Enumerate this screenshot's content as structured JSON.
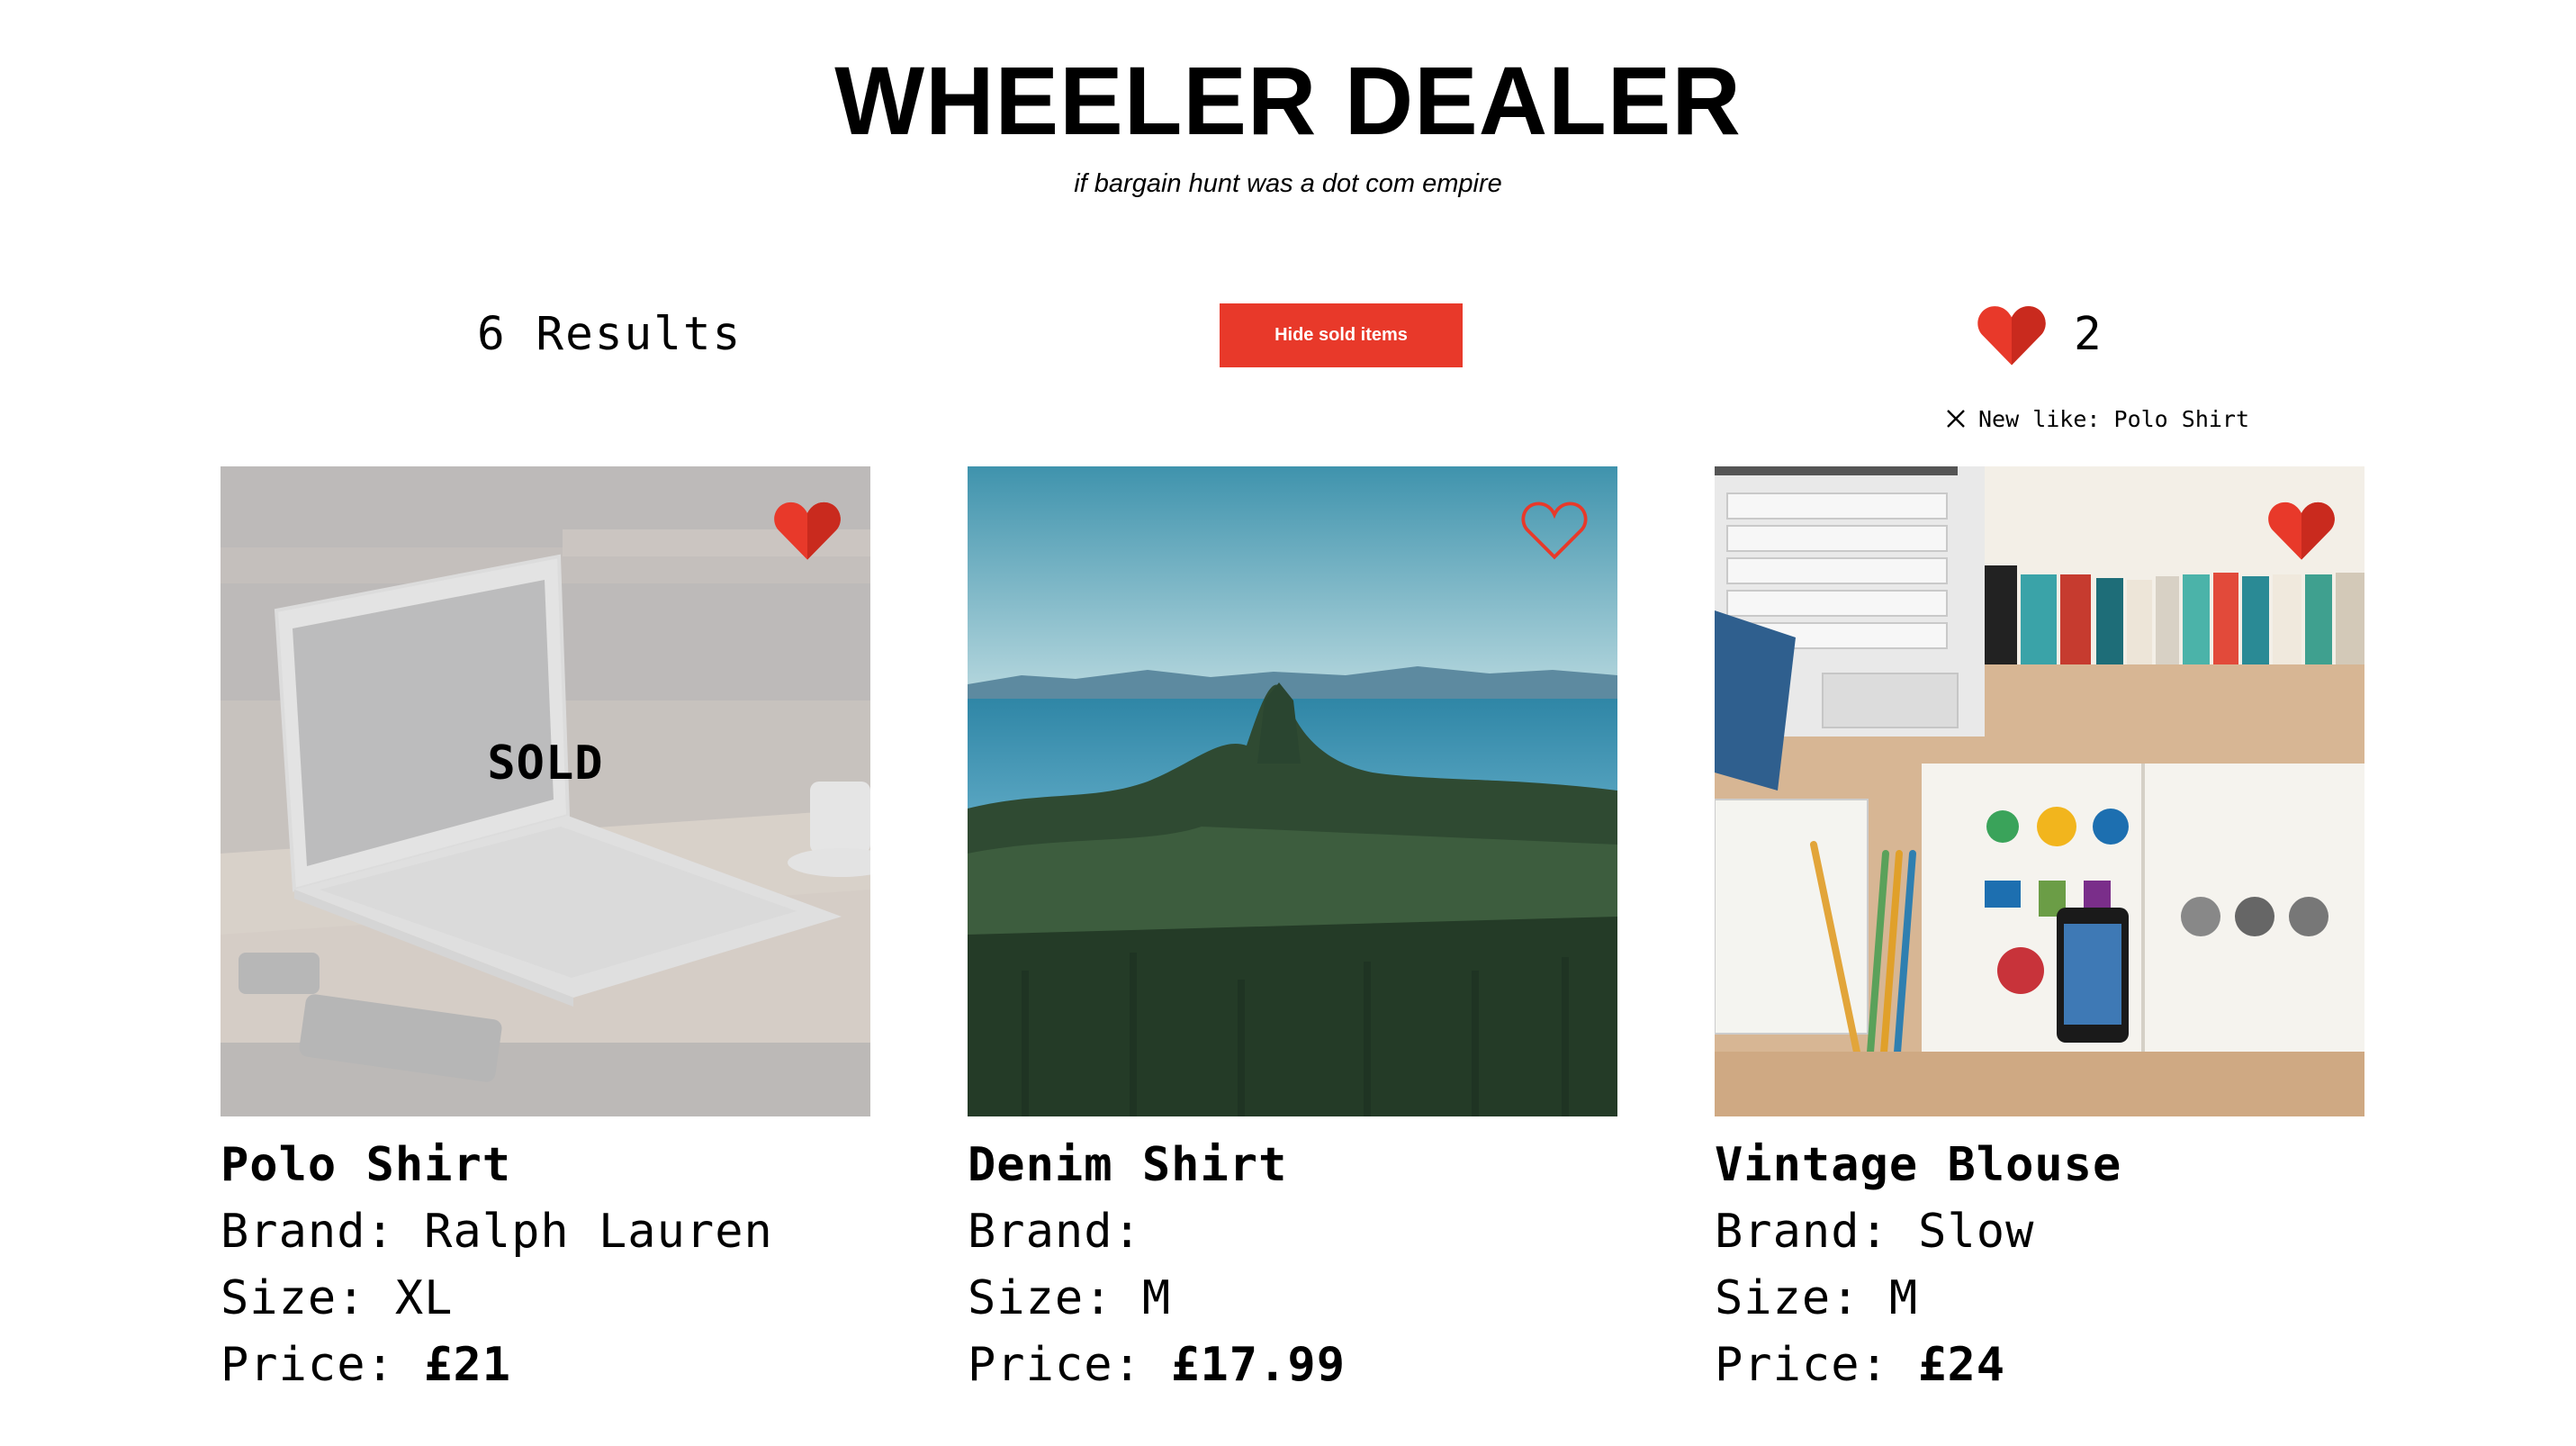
{
  "header": {
    "title": "WHEELER DEALER",
    "tagline": "if bargain hunt was a dot com empire"
  },
  "toolbar": {
    "results_label": "6 Results",
    "hide_sold_label": "Hide sold items",
    "likes_count": "2",
    "notice_text": "New like: Polo Shirt"
  },
  "colors": {
    "accent": "#e8392a",
    "heart": "#e8392a"
  },
  "icons": {
    "likes": "heart-icon",
    "notice_close": "close-icon",
    "favorite_filled": "heart-filled-icon",
    "favorite_outline": "heart-outline-icon"
  },
  "products": [
    {
      "name": "Polo Shirt",
      "brand_label": "Brand: ",
      "brand": "Ralph Lauren",
      "size_label": "Size: ",
      "size": "XL",
      "price_label": "Price: ",
      "price": "£21",
      "sold": true,
      "sold_label": "SOLD",
      "liked": true,
      "image": "laptop-on-desk"
    },
    {
      "name": "Denim Shirt",
      "brand_label": "Brand: ",
      "brand": "",
      "size_label": "Size: ",
      "size": "M",
      "price_label": "Price: ",
      "price": "£17.99",
      "sold": false,
      "liked": false,
      "image": "forest-and-sea"
    },
    {
      "name": "Vintage Blouse",
      "brand_label": "Brand: ",
      "brand": "Slow",
      "size_label": "Size: ",
      "size": "M",
      "price_label": "Price: ",
      "price": "£24",
      "sold": false,
      "liked": true,
      "image": "desk-with-books-and-phone"
    }
  ]
}
